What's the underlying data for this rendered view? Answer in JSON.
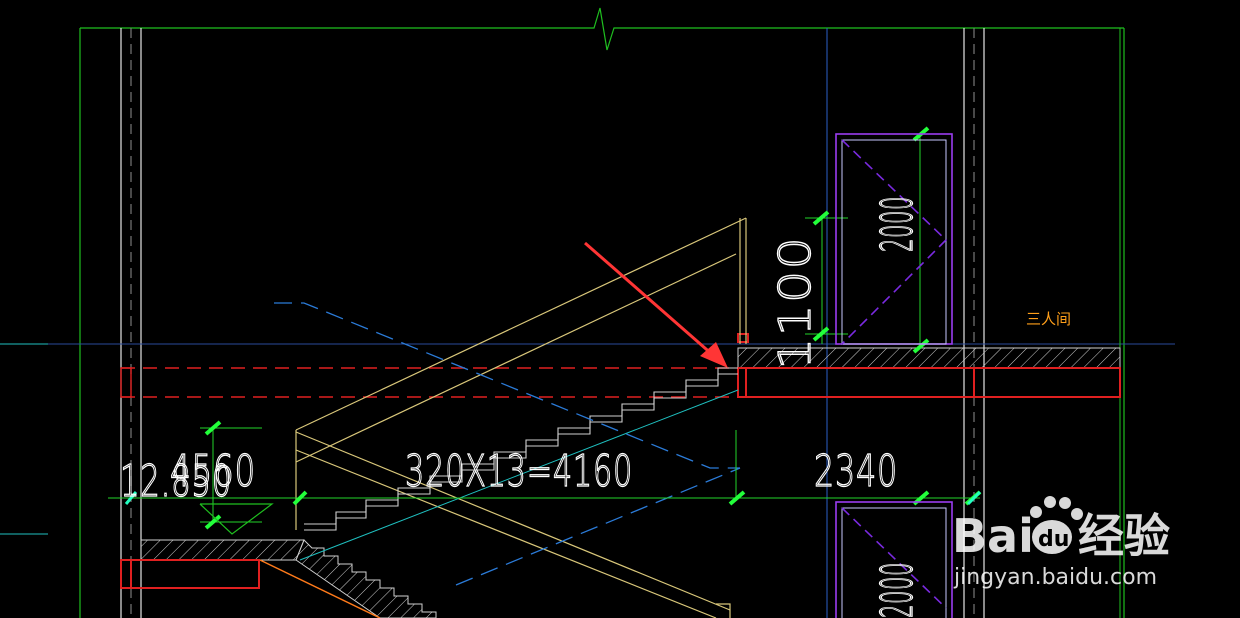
{
  "drawing": {
    "dimensions": {
      "flight": "320X13=4160",
      "landing": "2340",
      "left_overlap_a": "4560",
      "left_overlap_b": "12.850",
      "rail_height": "1100",
      "door_height": "2000",
      "door_height_lower": "2000"
    },
    "room_label": "三人间",
    "colors": {
      "wall": "#e6e6e6",
      "beam": "#e02020",
      "stair": "#d9c77a",
      "grid": "#2b7bd8",
      "dim_line": "#22d42a",
      "door": "#9a3df0",
      "arrow": "#ff3535",
      "room_label": "#ff9f1a"
    }
  },
  "watermark": {
    "brand": "Bai",
    "brand_suffix": "du",
    "cn": "经验",
    "url": "jingyan.baidu.com"
  }
}
